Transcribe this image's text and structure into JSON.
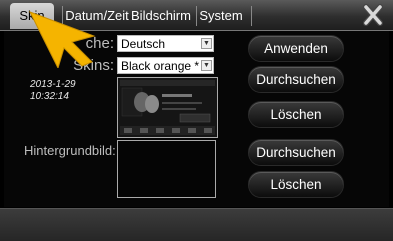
{
  "tabs": [
    {
      "label": "Skin",
      "active": true
    },
    {
      "label": "Datum/Zeit",
      "active": false
    },
    {
      "label": "Bildschirm",
      "active": false
    },
    {
      "label": "System",
      "active": false
    }
  ],
  "icons": {
    "close": "close-x-icon",
    "pointer": "pointer-arrow-icon",
    "dropdown": "chevron-down-icon"
  },
  "settings": {
    "language_label": "che:",
    "language_value": "Deutsch",
    "skins_label": "Skins:",
    "skins_value": "Black orange *",
    "background_label": "Hintergrundbild:"
  },
  "timestamp": {
    "date": "2013-1-29",
    "time": "10:32:14"
  },
  "buttons": {
    "apply": "Anwenden",
    "browse_skin": "Durchsuchen",
    "delete_skin": "Löschen",
    "browse_bg": "Durchsuchen",
    "delete_bg": "Löschen"
  },
  "colors": {
    "accent": "#f5b400",
    "tab_active": "#bfbfbf",
    "background": "#000000"
  }
}
